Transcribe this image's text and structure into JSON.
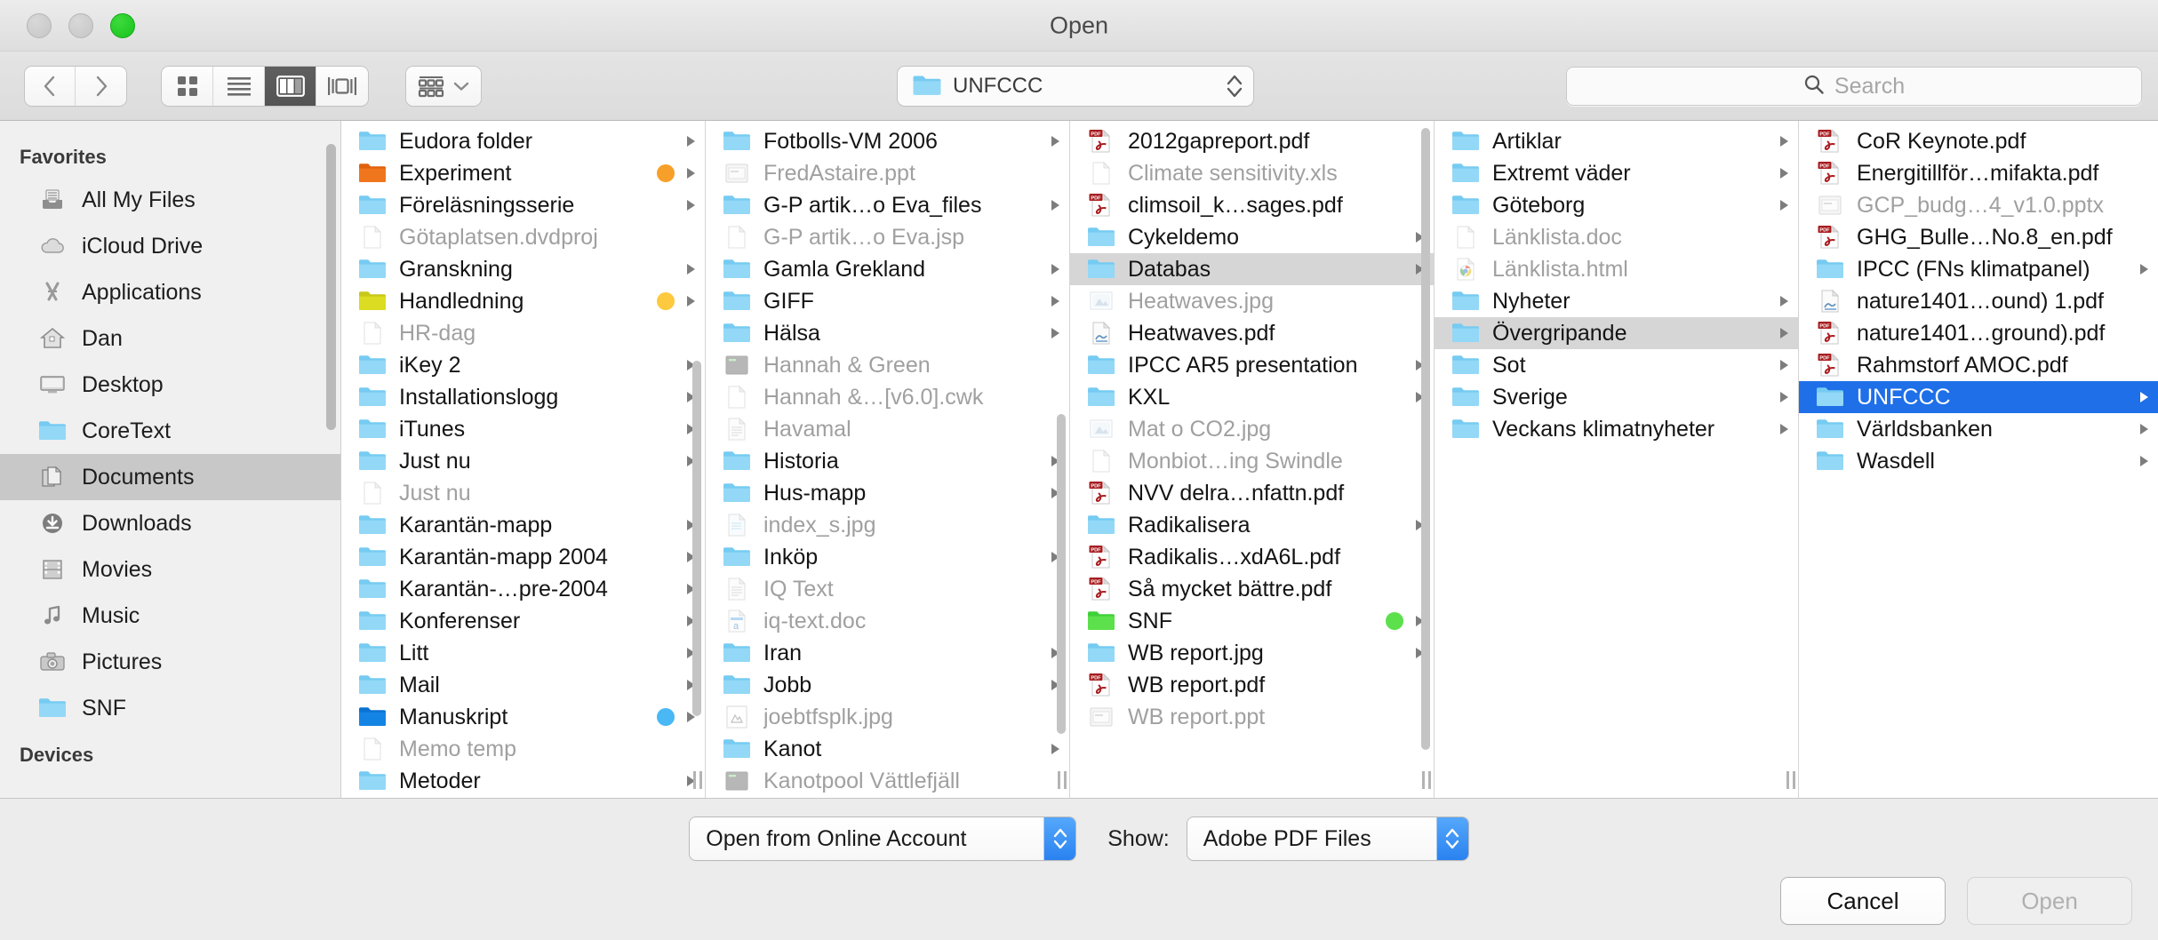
{
  "window": {
    "title": "Open",
    "traffic_lights": [
      "close",
      "minimize",
      "zoom"
    ]
  },
  "toolbar": {
    "back_icon": "chevron-left-icon",
    "forward_icon": "chevron-right-icon",
    "view_modes": [
      {
        "name": "icon-view",
        "icon": "grid-icon",
        "active": false
      },
      {
        "name": "list-view",
        "icon": "list-icon",
        "active": false
      },
      {
        "name": "column-view",
        "icon": "columns-icon",
        "active": true
      },
      {
        "name": "coverflow-view",
        "icon": "coverflow-icon",
        "active": false
      }
    ],
    "arrange": {
      "icon": "arrange-icon",
      "chevron": "chevron-down-icon"
    },
    "path": {
      "folder_icon": "folder-icon",
      "label": "UNFCCC",
      "stepper_icon": "stepper-icon"
    },
    "search": {
      "icon": "search-icon",
      "placeholder": "Search",
      "value": ""
    }
  },
  "sidebar": {
    "sections": [
      {
        "header": "Favorites",
        "items": [
          {
            "label": "All My Files",
            "icon": "all-my-files-icon",
            "selected": false
          },
          {
            "label": "iCloud Drive",
            "icon": "cloud-icon",
            "selected": false
          },
          {
            "label": "Applications",
            "icon": "applications-icon",
            "selected": false
          },
          {
            "label": "Dan",
            "icon": "home-icon",
            "selected": false
          },
          {
            "label": "Desktop",
            "icon": "desktop-icon",
            "selected": false
          },
          {
            "label": "CoreText",
            "icon": "folder-icon",
            "selected": false
          },
          {
            "label": "Documents",
            "icon": "documents-icon",
            "selected": true
          },
          {
            "label": "Downloads",
            "icon": "downloads-icon",
            "selected": false
          },
          {
            "label": "Movies",
            "icon": "movies-icon",
            "selected": false
          },
          {
            "label": "Music",
            "icon": "music-icon",
            "selected": false
          },
          {
            "label": "Pictures",
            "icon": "pictures-icon",
            "selected": false
          },
          {
            "label": "SNF",
            "icon": "folder-icon",
            "selected": false
          }
        ]
      },
      {
        "header": "Devices",
        "items": []
      }
    ]
  },
  "columns": [
    {
      "rows": [
        {
          "label": "Eudora folder",
          "icon": "folder-icon",
          "dim": false,
          "arrow": true,
          "tag": null,
          "selected": null
        },
        {
          "label": "Experiment",
          "icon": "folder-orange-icon",
          "dim": false,
          "arrow": true,
          "tag": "#f6a02a",
          "selected": null
        },
        {
          "label": "Föreläsningsserie",
          "icon": "folder-icon",
          "dim": false,
          "arrow": true,
          "tag": null,
          "selected": null
        },
        {
          "label": "Götaplatsen.dvdproj",
          "icon": "generic-doc-icon",
          "dim": true,
          "arrow": false,
          "tag": null,
          "selected": null
        },
        {
          "label": "Granskning",
          "icon": "folder-icon",
          "dim": false,
          "arrow": true,
          "tag": null,
          "selected": null
        },
        {
          "label": "Handledning",
          "icon": "folder-yellow-icon",
          "dim": false,
          "arrow": true,
          "tag": "#fcc93f",
          "selected": null
        },
        {
          "label": "HR-dag",
          "icon": "generic-doc-icon",
          "dim": true,
          "arrow": false,
          "tag": null,
          "selected": null
        },
        {
          "label": "iKey 2",
          "icon": "folder-icon",
          "dim": false,
          "arrow": true,
          "tag": null,
          "selected": null
        },
        {
          "label": "Installationslogg",
          "icon": "folder-icon",
          "dim": false,
          "arrow": true,
          "tag": null,
          "selected": null
        },
        {
          "label": "iTunes",
          "icon": "folder-icon",
          "dim": false,
          "arrow": true,
          "tag": null,
          "selected": null
        },
        {
          "label": "Just nu",
          "icon": "folder-icon",
          "dim": false,
          "arrow": true,
          "tag": null,
          "selected": null
        },
        {
          "label": "Just nu",
          "icon": "generic-doc-icon",
          "dim": true,
          "arrow": false,
          "tag": null,
          "selected": null
        },
        {
          "label": "Karantän-mapp",
          "icon": "folder-icon",
          "dim": false,
          "arrow": true,
          "tag": null,
          "selected": null
        },
        {
          "label": "Karantän-mapp 2004",
          "icon": "folder-icon",
          "dim": false,
          "arrow": true,
          "tag": null,
          "selected": null
        },
        {
          "label": "Karantän-…pre-2004",
          "icon": "folder-icon",
          "dim": false,
          "arrow": true,
          "tag": null,
          "selected": null
        },
        {
          "label": "Konferenser",
          "icon": "folder-icon",
          "dim": false,
          "arrow": true,
          "tag": null,
          "selected": null
        },
        {
          "label": "Litt",
          "icon": "folder-icon",
          "dim": false,
          "arrow": true,
          "tag": null,
          "selected": null
        },
        {
          "label": "Mail",
          "icon": "folder-icon",
          "dim": false,
          "arrow": true,
          "tag": null,
          "selected": null
        },
        {
          "label": "Manuskript",
          "icon": "folder-blue-icon",
          "dim": false,
          "arrow": true,
          "tag": "#49b8f5",
          "selected": null
        },
        {
          "label": "Memo temp",
          "icon": "generic-doc-icon",
          "dim": true,
          "arrow": false,
          "tag": null,
          "selected": null
        },
        {
          "label": "Metoder",
          "icon": "folder-icon",
          "dim": false,
          "arrow": true,
          "tag": null,
          "selected": null
        }
      ]
    },
    {
      "rows": [
        {
          "label": "Fotbolls-VM 2006",
          "icon": "folder-icon",
          "dim": false,
          "arrow": true,
          "tag": null,
          "selected": null
        },
        {
          "label": "FredAstaire.ppt",
          "icon": "powerpoint-icon",
          "dim": true,
          "arrow": false,
          "tag": null,
          "selected": null
        },
        {
          "label": "G-P artik…o Eva_files",
          "icon": "folder-icon",
          "dim": false,
          "arrow": true,
          "tag": null,
          "selected": null
        },
        {
          "label": "G-P artik…o Eva.jsp",
          "icon": "generic-doc-icon",
          "dim": true,
          "arrow": false,
          "tag": null,
          "selected": null
        },
        {
          "label": "Gamla Grekland",
          "icon": "folder-icon",
          "dim": false,
          "arrow": true,
          "tag": null,
          "selected": null
        },
        {
          "label": "GIFF",
          "icon": "folder-icon",
          "dim": false,
          "arrow": true,
          "tag": null,
          "selected": null
        },
        {
          "label": "Hälsa",
          "icon": "folder-icon",
          "dim": false,
          "arrow": true,
          "tag": null,
          "selected": null
        },
        {
          "label": "Hannah & Green",
          "icon": "app-icon",
          "dim": true,
          "arrow": false,
          "tag": null,
          "selected": null
        },
        {
          "label": "Hannah &…[v6.0].cwk",
          "icon": "generic-doc-icon",
          "dim": true,
          "arrow": false,
          "tag": null,
          "selected": null
        },
        {
          "label": "Havamal",
          "icon": "text-doc-icon",
          "dim": true,
          "arrow": false,
          "tag": null,
          "selected": null
        },
        {
          "label": "Historia",
          "icon": "folder-icon",
          "dim": false,
          "arrow": true,
          "tag": null,
          "selected": null
        },
        {
          "label": "Hus-mapp",
          "icon": "folder-icon",
          "dim": false,
          "arrow": true,
          "tag": null,
          "selected": null
        },
        {
          "label": "index_s.jpg",
          "icon": "image-doc-icon",
          "dim": true,
          "arrow": false,
          "tag": null,
          "selected": null
        },
        {
          "label": "Inköp",
          "icon": "folder-icon",
          "dim": false,
          "arrow": true,
          "tag": null,
          "selected": null
        },
        {
          "label": "IQ Text",
          "icon": "text-doc-icon",
          "dim": true,
          "arrow": false,
          "tag": null,
          "selected": null
        },
        {
          "label": "iq-text.doc",
          "icon": "word-doc-icon",
          "dim": true,
          "arrow": false,
          "tag": null,
          "selected": null
        },
        {
          "label": "Iran",
          "icon": "folder-icon",
          "dim": false,
          "arrow": true,
          "tag": null,
          "selected": null
        },
        {
          "label": "Jobb",
          "icon": "folder-icon",
          "dim": false,
          "arrow": true,
          "tag": null,
          "selected": null
        },
        {
          "label": "joebtfsplk.jpg",
          "icon": "photo-doc-icon",
          "dim": true,
          "arrow": false,
          "tag": null,
          "selected": null
        },
        {
          "label": "Kanot",
          "icon": "folder-icon",
          "dim": false,
          "arrow": true,
          "tag": null,
          "selected": null
        },
        {
          "label": "Kanotpool Vättlefjäll",
          "icon": "app-icon",
          "dim": true,
          "arrow": false,
          "tag": null,
          "selected": null
        }
      ]
    },
    {
      "rows": [
        {
          "label": "2012gapreport.pdf",
          "icon": "pdf-icon",
          "dim": false,
          "arrow": false,
          "tag": null,
          "selected": null
        },
        {
          "label": "Climate sensitivity.xls",
          "icon": "generic-doc-icon",
          "dim": true,
          "arrow": false,
          "tag": null,
          "selected": null
        },
        {
          "label": "climsoil_k…sages.pdf",
          "icon": "pdf-icon",
          "dim": false,
          "arrow": false,
          "tag": null,
          "selected": null
        },
        {
          "label": "Cykeldemo",
          "icon": "folder-icon",
          "dim": false,
          "arrow": true,
          "tag": null,
          "selected": null
        },
        {
          "label": "Databas",
          "icon": "folder-icon",
          "dim": false,
          "arrow": true,
          "tag": null,
          "selected": "gray"
        },
        {
          "label": "Heatwaves.jpg",
          "icon": "preview-image-icon",
          "dim": true,
          "arrow": false,
          "tag": null,
          "selected": null
        },
        {
          "label": "Heatwaves.pdf",
          "icon": "preview-pdf-icon",
          "dim": false,
          "arrow": false,
          "tag": null,
          "selected": null
        },
        {
          "label": "IPCC AR5 presentation",
          "icon": "folder-icon",
          "dim": false,
          "arrow": true,
          "tag": null,
          "selected": null
        },
        {
          "label": "KXL",
          "icon": "folder-icon",
          "dim": false,
          "arrow": true,
          "tag": null,
          "selected": null
        },
        {
          "label": "Mat o CO2.jpg",
          "icon": "preview-image-icon",
          "dim": true,
          "arrow": false,
          "tag": null,
          "selected": null
        },
        {
          "label": "Monbiot…ing Swindle",
          "icon": "generic-doc-icon",
          "dim": true,
          "arrow": false,
          "tag": null,
          "selected": null
        },
        {
          "label": "NVV delra…nfattn.pdf",
          "icon": "pdf-icon",
          "dim": false,
          "arrow": false,
          "tag": null,
          "selected": null
        },
        {
          "label": "Radikalisera",
          "icon": "folder-icon",
          "dim": false,
          "arrow": true,
          "tag": null,
          "selected": null
        },
        {
          "label": "Radikalis…xdA6L.pdf",
          "icon": "pdf-icon",
          "dim": false,
          "arrow": false,
          "tag": null,
          "selected": null
        },
        {
          "label": "Så mycket bättre.pdf",
          "icon": "pdf-icon",
          "dim": false,
          "arrow": false,
          "tag": null,
          "selected": null
        },
        {
          "label": "SNF",
          "icon": "folder-green-icon",
          "dim": false,
          "arrow": true,
          "tag": "#5ce04b",
          "selected": null
        },
        {
          "label": "WB report.jpg",
          "icon": "folder-icon",
          "dim": false,
          "arrow": true,
          "tag": null,
          "selected": null
        },
        {
          "label": "WB report.pdf",
          "icon": "pdf-icon",
          "dim": false,
          "arrow": false,
          "tag": null,
          "selected": null
        },
        {
          "label": "WB report.ppt",
          "icon": "powerpoint-icon",
          "dim": true,
          "arrow": false,
          "tag": null,
          "selected": null
        }
      ]
    },
    {
      "rows": [
        {
          "label": "Artiklar",
          "icon": "folder-icon",
          "dim": false,
          "arrow": true,
          "tag": null,
          "selected": null
        },
        {
          "label": "Extremt väder",
          "icon": "folder-icon",
          "dim": false,
          "arrow": true,
          "tag": null,
          "selected": null
        },
        {
          "label": "Göteborg",
          "icon": "folder-icon",
          "dim": false,
          "arrow": true,
          "tag": null,
          "selected": null
        },
        {
          "label": "Länklista.doc",
          "icon": "generic-doc-icon",
          "dim": true,
          "arrow": false,
          "tag": null,
          "selected": null
        },
        {
          "label": "Länklista.html",
          "icon": "chrome-doc-icon",
          "dim": true,
          "arrow": false,
          "tag": null,
          "selected": null
        },
        {
          "label": "Nyheter",
          "icon": "folder-icon",
          "dim": false,
          "arrow": true,
          "tag": null,
          "selected": null
        },
        {
          "label": "Övergripande",
          "icon": "folder-icon",
          "dim": false,
          "arrow": true,
          "tag": null,
          "selected": "gray"
        },
        {
          "label": "Sot",
          "icon": "folder-icon",
          "dim": false,
          "arrow": true,
          "tag": null,
          "selected": null
        },
        {
          "label": "Sverige",
          "icon": "folder-icon",
          "dim": false,
          "arrow": true,
          "tag": null,
          "selected": null
        },
        {
          "label": "Veckans klimatnyheter",
          "icon": "folder-icon",
          "dim": false,
          "arrow": true,
          "tag": null,
          "selected": null
        }
      ]
    },
    {
      "rows": [
        {
          "label": "CoR Keynote.pdf",
          "icon": "pdf-icon",
          "dim": false,
          "arrow": false,
          "tag": null,
          "selected": null
        },
        {
          "label": "Energitillför…mifakta.pdf",
          "icon": "pdf-icon",
          "dim": false,
          "arrow": false,
          "tag": null,
          "selected": null
        },
        {
          "label": "GCP_budg…4_v1.0.pptx",
          "icon": "powerpoint-icon",
          "dim": true,
          "arrow": false,
          "tag": null,
          "selected": null
        },
        {
          "label": "GHG_Bulle…No.8_en.pdf",
          "icon": "pdf-icon",
          "dim": false,
          "arrow": false,
          "tag": null,
          "selected": null
        },
        {
          "label": "IPCC (FNs klimatpanel)",
          "icon": "folder-icon",
          "dim": false,
          "arrow": true,
          "tag": null,
          "selected": null
        },
        {
          "label": "nature1401…ound) 1.pdf",
          "icon": "preview-pdf-icon",
          "dim": false,
          "arrow": false,
          "tag": null,
          "selected": null
        },
        {
          "label": "nature1401…ground).pdf",
          "icon": "pdf-icon",
          "dim": false,
          "arrow": false,
          "tag": null,
          "selected": null
        },
        {
          "label": "Rahmstorf AMOC.pdf",
          "icon": "pdf-icon",
          "dim": false,
          "arrow": false,
          "tag": null,
          "selected": null
        },
        {
          "label": "UNFCCC",
          "icon": "folder-icon",
          "dim": false,
          "arrow": true,
          "tag": null,
          "selected": "blue"
        },
        {
          "label": "Världsbanken",
          "icon": "folder-icon",
          "dim": false,
          "arrow": true,
          "tag": null,
          "selected": null
        },
        {
          "label": "Wasdell",
          "icon": "folder-icon",
          "dim": false,
          "arrow": true,
          "tag": null,
          "selected": null
        }
      ]
    }
  ],
  "bottom": {
    "online_account_label": "Open from Online Account",
    "show_label": "Show:",
    "file_filter_value": "Adobe PDF Files",
    "cancel_label": "Cancel",
    "open_label": "Open",
    "open_disabled": true
  },
  "colors": {
    "selection_blue": "#1e6fe8",
    "folder_blue": "#6ec9f0",
    "pdf_red": "#b22222",
    "tag_orange": "#f6a02a",
    "tag_yellow": "#fcc93f",
    "tag_green": "#5ce04b",
    "tag_blue": "#49b8f5"
  }
}
